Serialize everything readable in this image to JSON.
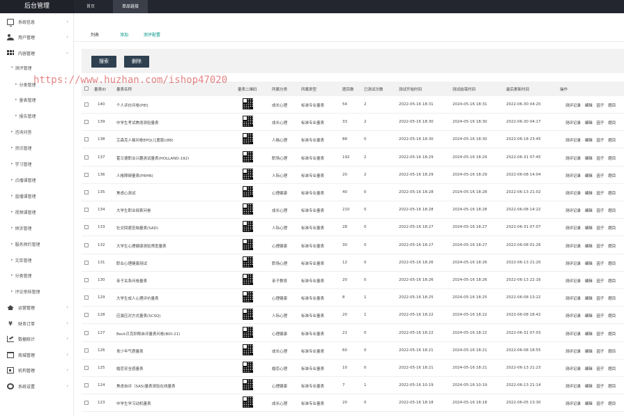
{
  "header": {
    "app_title": "后台管理",
    "nav": [
      {
        "label": "首页"
      },
      {
        "label": "单品链接"
      }
    ]
  },
  "sidebar": {
    "items": [
      {
        "label": "系统信息",
        "icon": "monitor-icon"
      },
      {
        "label": "用户管理",
        "icon": "users-icon"
      },
      {
        "label": "内容管理",
        "icon": "grid-icon"
      },
      {
        "label": "运营管理",
        "icon": "graduation-cap-icon"
      },
      {
        "label": "财务订单",
        "icon": "yen-icon"
      },
      {
        "label": "数据统计",
        "icon": "chart-icon"
      },
      {
        "label": "商城管理",
        "icon": "cart-icon"
      },
      {
        "label": "机构管理",
        "icon": "building-icon"
      },
      {
        "label": "系统设置",
        "icon": "gear-icon"
      }
    ],
    "content_sub": [
      {
        "label": "测评管理"
      },
      {
        "label": "分类管理"
      },
      {
        "label": "量表管理"
      },
      {
        "label": "报告管理"
      },
      {
        "label": "咨询问答"
      },
      {
        "label": "资讯管理"
      },
      {
        "label": "学习管理"
      },
      {
        "label": "点播课管理"
      },
      {
        "label": "直播课管理"
      },
      {
        "label": "视频课管理"
      },
      {
        "label": "倾诉管理"
      },
      {
        "label": "服务预约管理"
      },
      {
        "label": "文库管理"
      },
      {
        "label": "分类管理"
      },
      {
        "label": "评论审核管理"
      }
    ]
  },
  "tabs": [
    {
      "label": "列表"
    },
    {
      "label": "添加"
    },
    {
      "label": "测评配置"
    }
  ],
  "toolbar": {
    "search_label": "搜索",
    "delete_label": "删除"
  },
  "watermark": "https://www.huzhan.com/ishop47020",
  "table": {
    "headers": {
      "id": "量表ID",
      "name": "量表名称",
      "qr": "量表二维码",
      "category": "所属分类",
      "type": "所属类型",
      "questions": "题目数",
      "tested": "已测试次数",
      "start": "测试开始时间",
      "end": "测试结束时间",
      "updated": "最后更新时间",
      "ops": "操作"
    },
    "ops_labels": [
      "测评记录",
      "编辑",
      "因子",
      "题目"
    ],
    "rows": [
      {
        "id": "140",
        "name": "个人评价问卷(PEI)",
        "category": "成长心理",
        "type": "标准专业量表",
        "questions": "54",
        "tested": "2",
        "start": "2022-05-16 18:31",
        "end": "2024-05-16 18:31",
        "updated": "2022-06-30 04:20"
      },
      {
        "id": "139",
        "name": "中学生考试焦虑测验量表",
        "category": "成长心理",
        "type": "标准专业量表",
        "questions": "33",
        "tested": "2",
        "start": "2022-05-16 18:30",
        "end": "2024-05-16 18:30",
        "updated": "2022-06-30 04:17"
      },
      {
        "id": "138",
        "name": "艾森克人格问卷EPQ(儿童版)(88)",
        "category": "人格心理",
        "type": "标准专业量表",
        "questions": "88",
        "tested": "0",
        "start": "2022-05-16 18:30",
        "end": "2024-05-16 18:30",
        "updated": "2022-06-18 23:45"
      },
      {
        "id": "137",
        "name": "霍兰德职业兴趣测试量表(HOLLAND-192)",
        "category": "职场心理",
        "type": "标准专业量表",
        "questions": "192",
        "tested": "2",
        "start": "2022-05-16 18:29",
        "end": "2024-05-16 18:29",
        "updated": "2022-06-31 07:45"
      },
      {
        "id": "136",
        "name": "人格障碍量表(PRHN)",
        "category": "人际心理",
        "type": "标准专业量表",
        "questions": "20",
        "tested": "2",
        "start": "2022-05-16 18:29",
        "end": "2024-05-16 18:29",
        "updated": "2022-06-08 14:04"
      },
      {
        "id": "135",
        "name": "焦虑心测试",
        "category": "心理健康",
        "type": "标准专业量表",
        "questions": "40",
        "tested": "0",
        "start": "2022-05-16 18:28",
        "end": "2024-05-16 18:28",
        "updated": "2022-06-13 21:02"
      },
      {
        "id": "134",
        "name": "大学生职业探索问卷",
        "category": "成长心理",
        "type": "标准专业量表",
        "questions": "210",
        "tested": "0",
        "start": "2022-05-16 18:28",
        "end": "2024-05-16 18:28",
        "updated": "2022-06-08 14:22"
      },
      {
        "id": "133",
        "name": "社交回避苦恼量表(SAD)",
        "category": "人际心理",
        "type": "标准专业量表",
        "questions": "28",
        "tested": "0",
        "start": "2022-05-16 18:27",
        "end": "2024-05-16 18:27",
        "updated": "2022-06-31 07:07"
      },
      {
        "id": "132",
        "name": "大学生心理健康测验筛查量表",
        "category": "心理健康",
        "type": "标准专业量表",
        "questions": "30",
        "tested": "0",
        "start": "2022-05-16 18:27",
        "end": "2024-05-16 18:27",
        "updated": "2022-06-08 01:26"
      },
      {
        "id": "131",
        "name": "职业心理健康测试",
        "category": "职场心理",
        "type": "标准专业量表",
        "questions": "12",
        "tested": "0",
        "start": "2022-05-16 18:26",
        "end": "2024-05-16 18:26",
        "updated": "2022-06-13 21:20"
      },
      {
        "id": "130",
        "name": "亲子关系问卷量表",
        "category": "亲子教育",
        "type": "标准专业量表",
        "questions": "20",
        "tested": "0",
        "start": "2022-05-16 18:26",
        "end": "2024-05-16 18:26",
        "updated": "2022-06-13 22:16"
      },
      {
        "id": "129",
        "name": "大学生成人心理评价量表",
        "category": "心理健康",
        "type": "标准专业量表",
        "questions": "8",
        "tested": "1",
        "start": "2022-05-16 18:25",
        "end": "2024-05-16 18:25",
        "updated": "2022-06-08 13:22"
      },
      {
        "id": "128",
        "name": "应激应对方式量表(SCSQ)",
        "category": "人际心理",
        "type": "标准专业量表",
        "questions": "20",
        "tested": "1",
        "start": "2022-05-16 18:22",
        "end": "2024-05-16 18:22",
        "updated": "2022-06-08 18:42"
      },
      {
        "id": "127",
        "name": "Beck贝克抑郁自评量表问卷(BDI-21)",
        "category": "心理健康",
        "type": "标准专业量表",
        "questions": "21",
        "tested": "0",
        "start": "2022-05-16 18:22",
        "end": "2024-05-16 18:22",
        "updated": "2022-06-31 07:03"
      },
      {
        "id": "126",
        "name": "青少年气质量表",
        "category": "成长心理",
        "type": "标准专业量表",
        "questions": "60",
        "tested": "0",
        "start": "2022-05-16 18:21",
        "end": "2024-05-16 18:21",
        "updated": "2022-06-08 18:55"
      },
      {
        "id": "125",
        "name": "婚恋安全感量表",
        "category": "婚恋心理",
        "type": "标准专业量表",
        "questions": "10",
        "tested": "0",
        "start": "2022-05-16 18:21",
        "end": "2024-05-16 18:21",
        "updated": "2022-06-13 21:23"
      },
      {
        "id": "124",
        "name": "焦虑自评（SAS)量表测验在线量表",
        "category": "心理健康",
        "type": "标准专业量表",
        "questions": "7",
        "tested": "1",
        "start": "2022-05-16 10:19",
        "end": "2024-05-16 10:19",
        "updated": "2022-06-13 21:14"
      },
      {
        "id": "123",
        "name": "中学生学习动机量表",
        "category": "成长心理",
        "type": "标准专业量表",
        "questions": "20",
        "tested": "0",
        "start": "2022-05-16 18:18",
        "end": "2024-05-16 18:18",
        "updated": "2022-06-05 13:30"
      }
    ]
  },
  "colors": {
    "topbar": "#23262e",
    "button": "#2f4050",
    "tab_active": "#333333",
    "tab_link": "#009688",
    "watermark": "#cd1e1e"
  }
}
